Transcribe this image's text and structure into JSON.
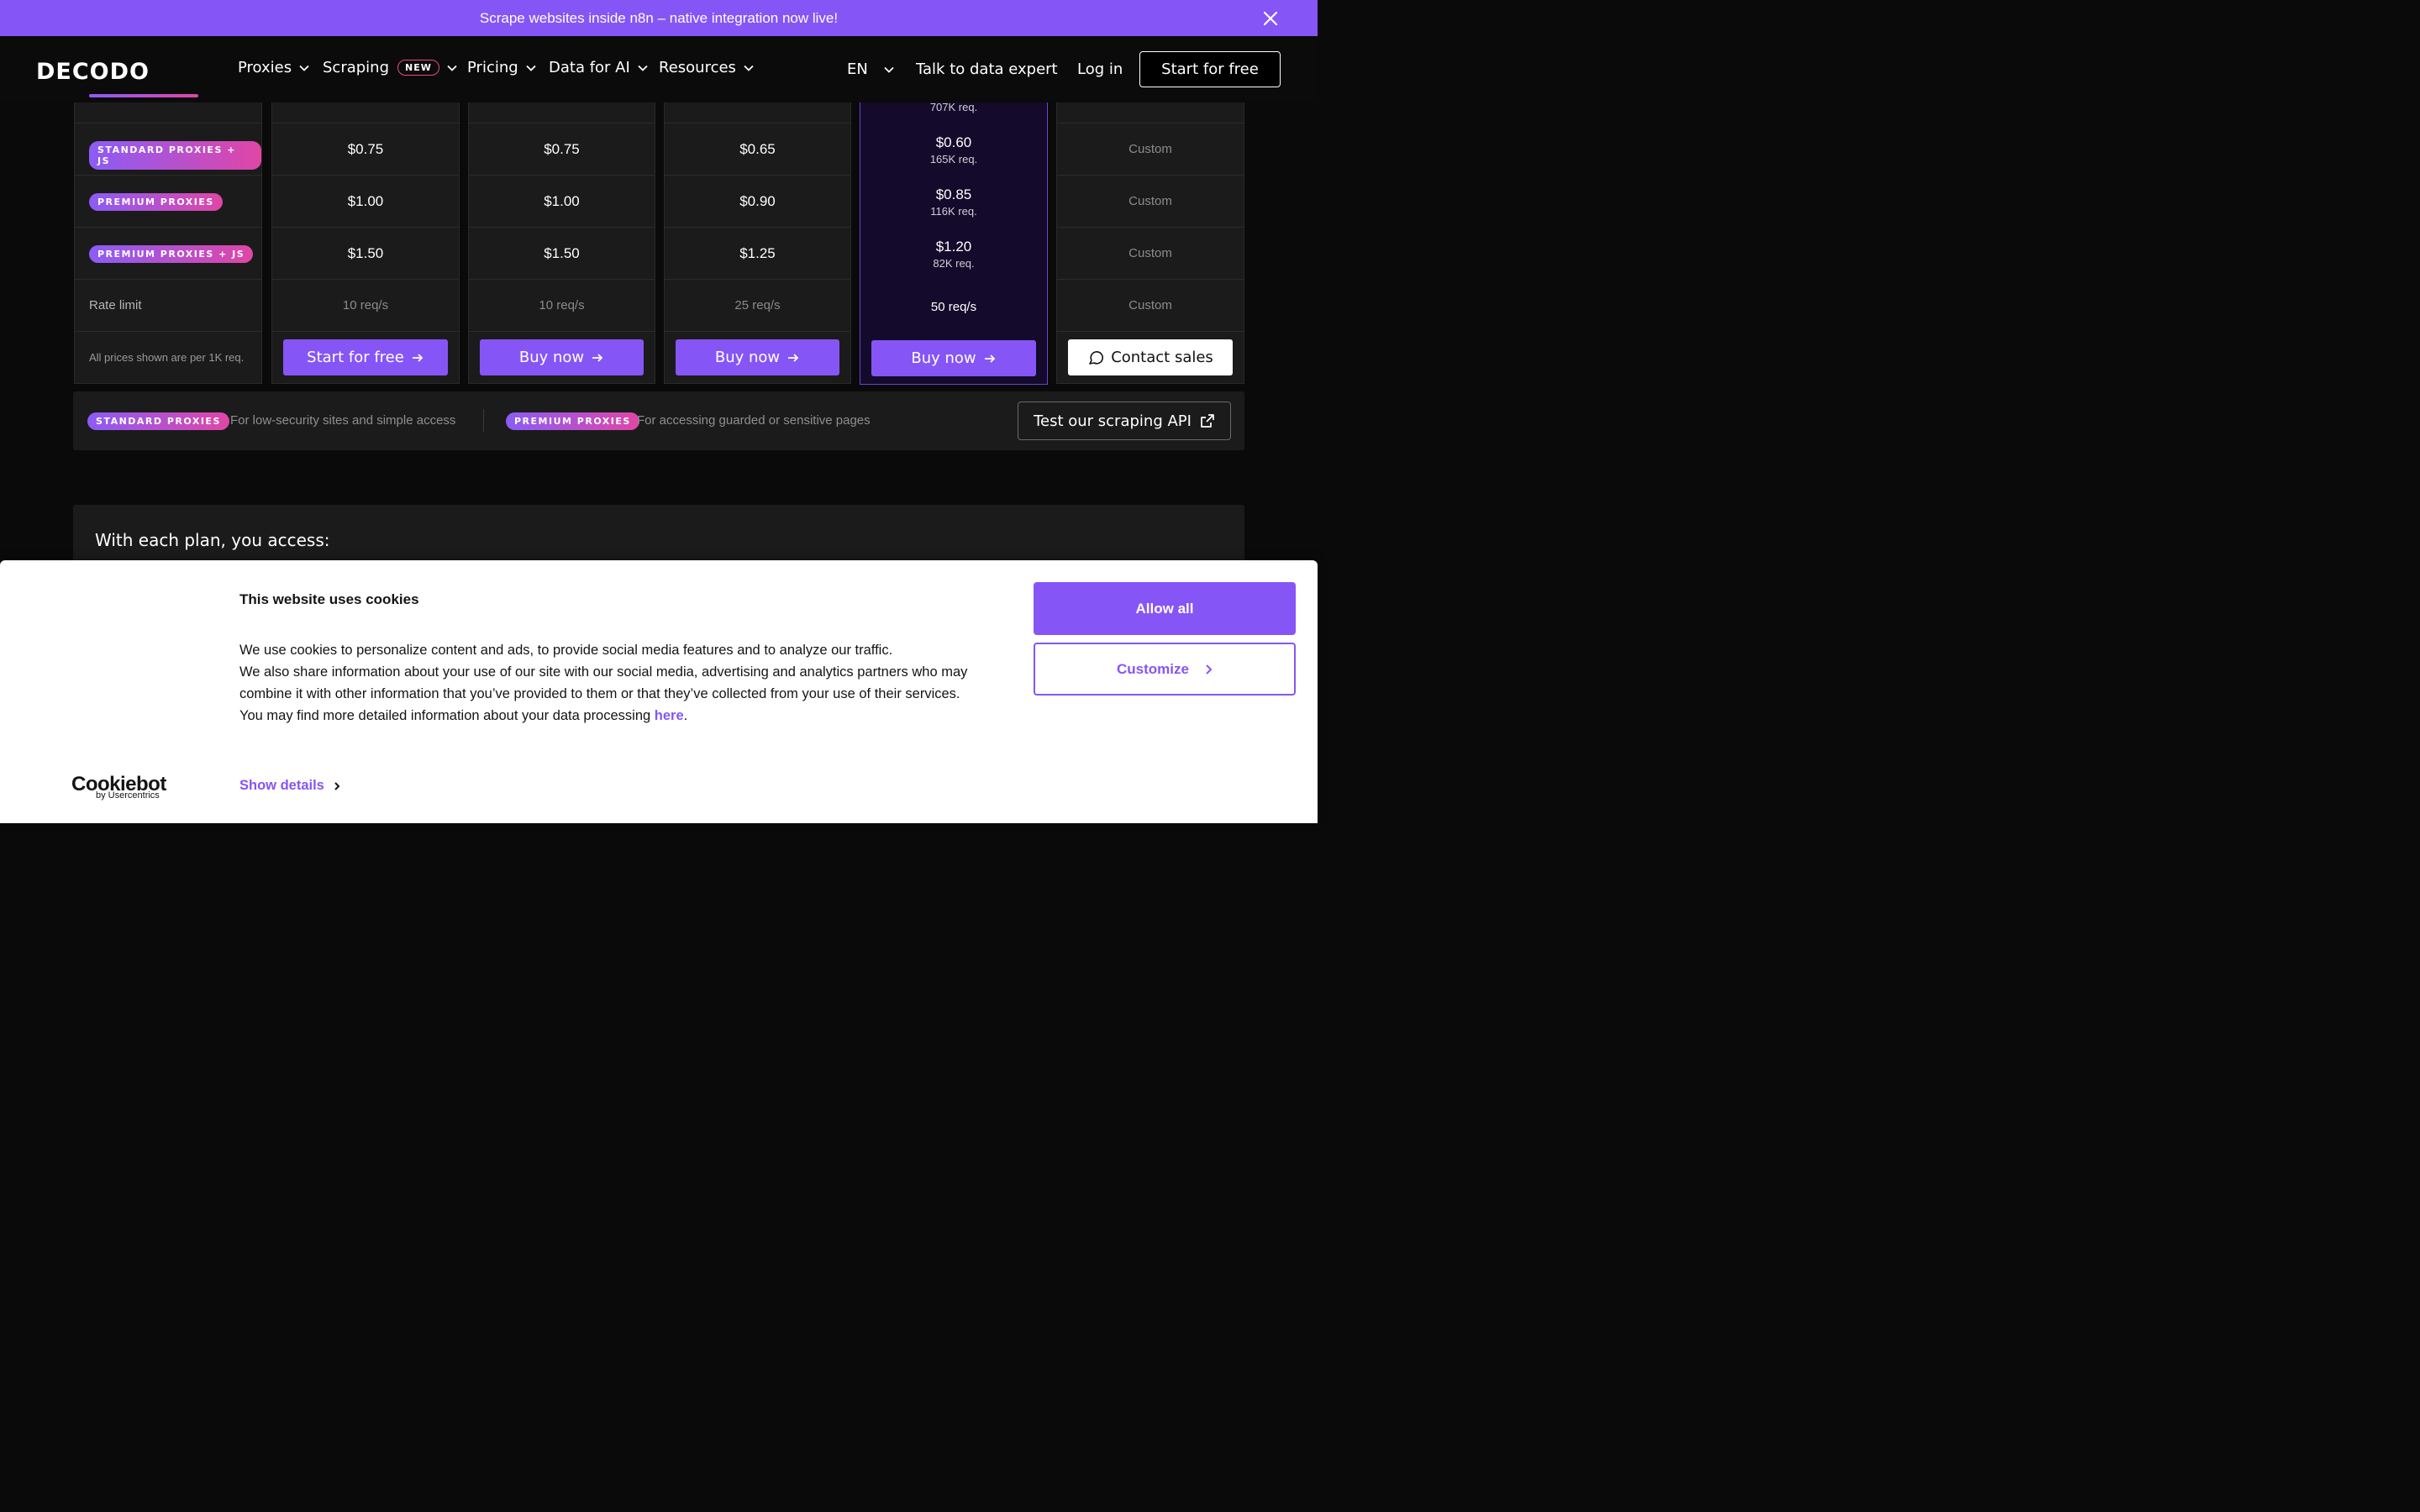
{
  "announcement": {
    "text": "Scrape websites inside n8n – native integration now live!"
  },
  "nav": {
    "logo": "DECODO",
    "items": [
      {
        "label": "Proxies"
      },
      {
        "label": "Scraping",
        "badge": "NEW"
      },
      {
        "label": "Pricing"
      },
      {
        "label": "Data for AI"
      },
      {
        "label": "Resources"
      }
    ],
    "language": "EN",
    "talk": "Talk to data expert",
    "login": "Log in",
    "start": "Start for free"
  },
  "table": {
    "partial_top": "707K req.",
    "labels": {
      "standard_js": "STANDARD PROXIES + JS",
      "premium": "PREMIUM PROXIES",
      "premium_js": "PREMIUM PROXIES + JS",
      "rate_limit": "Rate limit",
      "note": "All prices shown are per 1K req."
    },
    "plans": [
      {
        "standard_js": "$0.75",
        "premium": "$1.00",
        "premium_js": "$1.50",
        "rate": "10 req/s",
        "cta": "Start for free"
      },
      {
        "standard_js": "$0.75",
        "premium": "$1.00",
        "premium_js": "$1.50",
        "rate": "10 req/s",
        "cta": "Buy now"
      },
      {
        "standard_js": "$0.65",
        "premium": "$0.90",
        "premium_js": "$1.25",
        "rate": "25 req/s",
        "cta": "Buy now"
      },
      {
        "standard_js": "$0.60",
        "standard_js_sub": "165K req.",
        "premium": "$0.85",
        "premium_sub": "116K req.",
        "premium_js": "$1.20",
        "premium_js_sub": "82K req.",
        "rate": "50 req/s",
        "cta": "Buy now"
      },
      {
        "standard_js": "Custom",
        "premium": "Custom",
        "premium_js": "Custom",
        "rate": "Custom",
        "cta": "Contact sales"
      }
    ]
  },
  "legend": {
    "standard": "STANDARD PROXIES",
    "standard_desc": "For low-security sites and simple access",
    "premium": "PREMIUM PROXIES",
    "premium_desc": "For accessing guarded or sensitive pages",
    "test_api": "Test our scraping API"
  },
  "access": {
    "title": "With each plan, you access:"
  },
  "cookie": {
    "title": "This website uses cookies",
    "line1": "We use cookies to personalize content and ads, to provide social media features and to analyze our traffic.",
    "line2": "We also share information about your use of our site with our social media, advertising and analytics partners who may combine it with other information that you’ve provided to them or that they’ve collected from your use of their services.",
    "line3_prefix": "You may find more detailed information about your data processing ",
    "line3_link": "here",
    "line3_suffix": ".",
    "show_details": "Show details",
    "allow_all": "Allow all",
    "customize": "Customize",
    "brand": "Cookiebot",
    "brand_sub": "by Usercentrics"
  },
  "colors": {
    "accent": "#8655f6",
    "pill_gradient_end": "#e046a6",
    "background": "#0a0a0a"
  }
}
